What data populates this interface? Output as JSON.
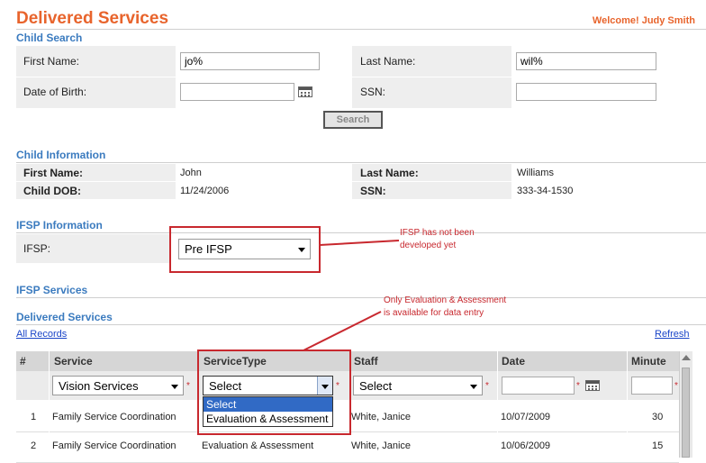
{
  "header": {
    "title": "Delivered Services",
    "welcome": "Welcome! Judy Smith"
  },
  "child_search": {
    "heading": "Child Search",
    "first_name_label": "First Name:",
    "first_name_value": "jo%",
    "last_name_label": "Last Name:",
    "last_name_value": "wil%",
    "dob_label": "Date of Birth:",
    "dob_value": "",
    "ssn_label": "SSN:",
    "ssn_value": "",
    "search_button": "Search"
  },
  "child_info": {
    "heading": "Child Information",
    "first_name_label": "First Name:",
    "first_name": "John",
    "last_name_label": "Last Name:",
    "last_name": "Williams",
    "dob_label": "Child DOB:",
    "dob": "11/24/2006",
    "ssn_label": "SSN:",
    "ssn": "333-34-1530"
  },
  "ifsp": {
    "heading": "IFSP Information",
    "label": "IFSP:",
    "selected": "Pre IFSP",
    "note": "IFSP has not been developed yet"
  },
  "ifsp_services": {
    "heading": "IFSP Services"
  },
  "delivered": {
    "heading": "Delivered Services",
    "note": "Only Evaluation & Assessment is available for data entry",
    "all_records": "All Records",
    "refresh": "Refresh",
    "columns": [
      "#",
      "Service",
      "ServiceType",
      "Staff",
      "Date",
      "Minute"
    ],
    "filters": {
      "service": "Vision Services",
      "service_type": "Select",
      "staff": "Select",
      "date": "",
      "minute": ""
    },
    "service_type_options": [
      "Select",
      "Evaluation & Assessment"
    ],
    "rows": [
      {
        "num": "1",
        "service": "Family Service Coordination",
        "service_type": "",
        "staff": "White, Janice",
        "date": "10/07/2009",
        "minute": "30"
      },
      {
        "num": "2",
        "service": "Family Service Coordination",
        "service_type": "Evaluation & Assessment",
        "staff": "White, Janice",
        "date": "10/06/2009",
        "minute": "15"
      }
    ]
  },
  "colors": {
    "accent": "#e8642c",
    "section": "#3b7bbf",
    "callout": "#c8282e",
    "link": "#1a45c8"
  }
}
